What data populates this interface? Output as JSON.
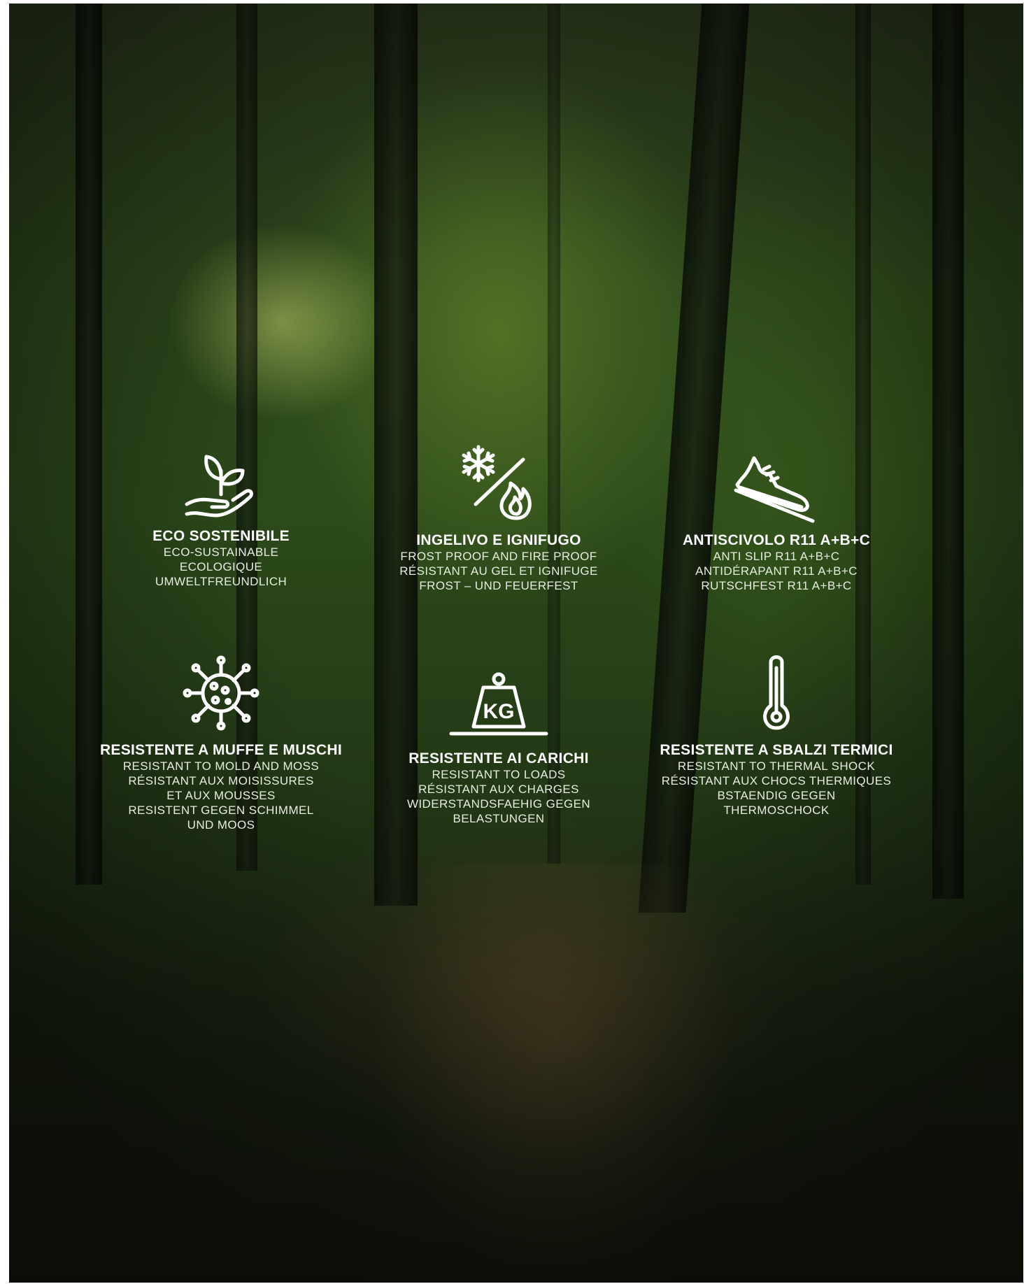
{
  "features": [
    {
      "icon": "plant-hand-icon",
      "title": "ECO SOSTENIBILE",
      "lines": [
        "ECO-SUSTAINABLE",
        "ECOLOGIQUE",
        "UMWELTFREUNDLICH"
      ]
    },
    {
      "icon": "frost-fire-icon",
      "title": "INGELIVO E IGNIFUGO",
      "lines": [
        "FROST PROOF AND FIRE PROOF",
        "RÉSISTANT AU GEL ET IGNIFUGE",
        "FROST – UND FEUERFEST"
      ]
    },
    {
      "icon": "slip-shoe-icon",
      "title": "ANTISCIVOLO R11 A+B+C",
      "lines": [
        "ANTI SLIP R11 A+B+C",
        "ANTIDÉRAPANT R11 A+B+C",
        "RUTSCHFEST R11 A+B+C"
      ]
    },
    {
      "icon": "mold-virus-icon",
      "title": "RESISTENTE A MUFFE E MUSCHI",
      "lines": [
        "RESISTANT TO MOLD AND MOSS",
        "RÉSISTANT AUX MOISISSURES",
        "ET AUX MOUSSES",
        "RESISTENT GEGEN SCHIMMEL",
        "UND MOOS"
      ]
    },
    {
      "icon": "kg-weight-icon",
      "title": "RESISTENTE AI CARICHI",
      "lines": [
        "RESISTANT TO LOADS",
        "RÉSISTANT AUX CHARGES",
        "WIDERSTANDSFAEHIG GEGEN",
        "BELASTUNGEN"
      ]
    },
    {
      "icon": "thermometer-icon",
      "title": "RESISTENTE A SBALZI TERMICI",
      "lines": [
        "RESISTANT TO THERMAL SHOCK",
        "RÉSISTANT AUX CHOCS THERMIQUES",
        "BSTAENDIG GEGEN",
        "THERMOSCHOCK"
      ]
    }
  ],
  "kg_label": "KG",
  "colors": {
    "text": "#ffffff",
    "background": "#2c4a1a"
  }
}
